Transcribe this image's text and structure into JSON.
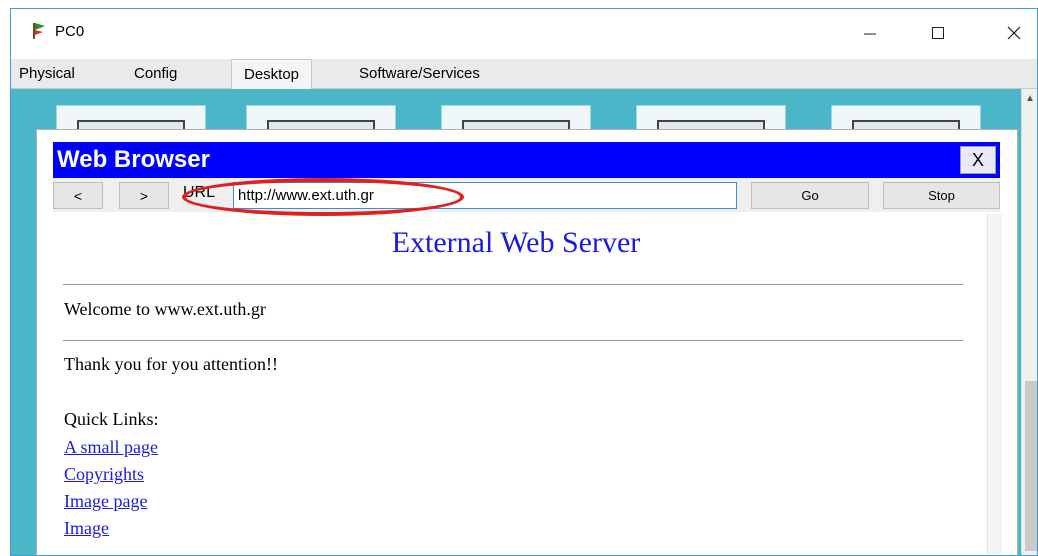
{
  "window": {
    "title": "PC0",
    "controls": {
      "minimize": "—",
      "maximize": "☐",
      "close": "✕"
    }
  },
  "tabs": [
    {
      "label": "Physical",
      "active": false
    },
    {
      "label": "Config",
      "active": false
    },
    {
      "label": "Desktop",
      "active": true
    },
    {
      "label": "Software/Services",
      "active": false
    }
  ],
  "browser": {
    "title": "Web Browser",
    "close_label": "X",
    "back_label": "<",
    "forward_label": ">",
    "url_label": "URL",
    "url_value": "http://www.ext.uth.gr",
    "go_label": "Go",
    "stop_label": "Stop"
  },
  "page": {
    "heading": "External Web Server",
    "welcome": "Welcome to www.ext.uth.gr",
    "thanks": "Thank you for you attention!!",
    "quick_links_label": "Quick Links:",
    "links": [
      "A small page",
      "Copyrights",
      "Image page",
      "Image"
    ]
  },
  "colors": {
    "desktop_bg": "#4ab6c8",
    "browser_titlebar": "#0000ff",
    "link": "#1a1ae0",
    "annotation": "#e02020"
  }
}
